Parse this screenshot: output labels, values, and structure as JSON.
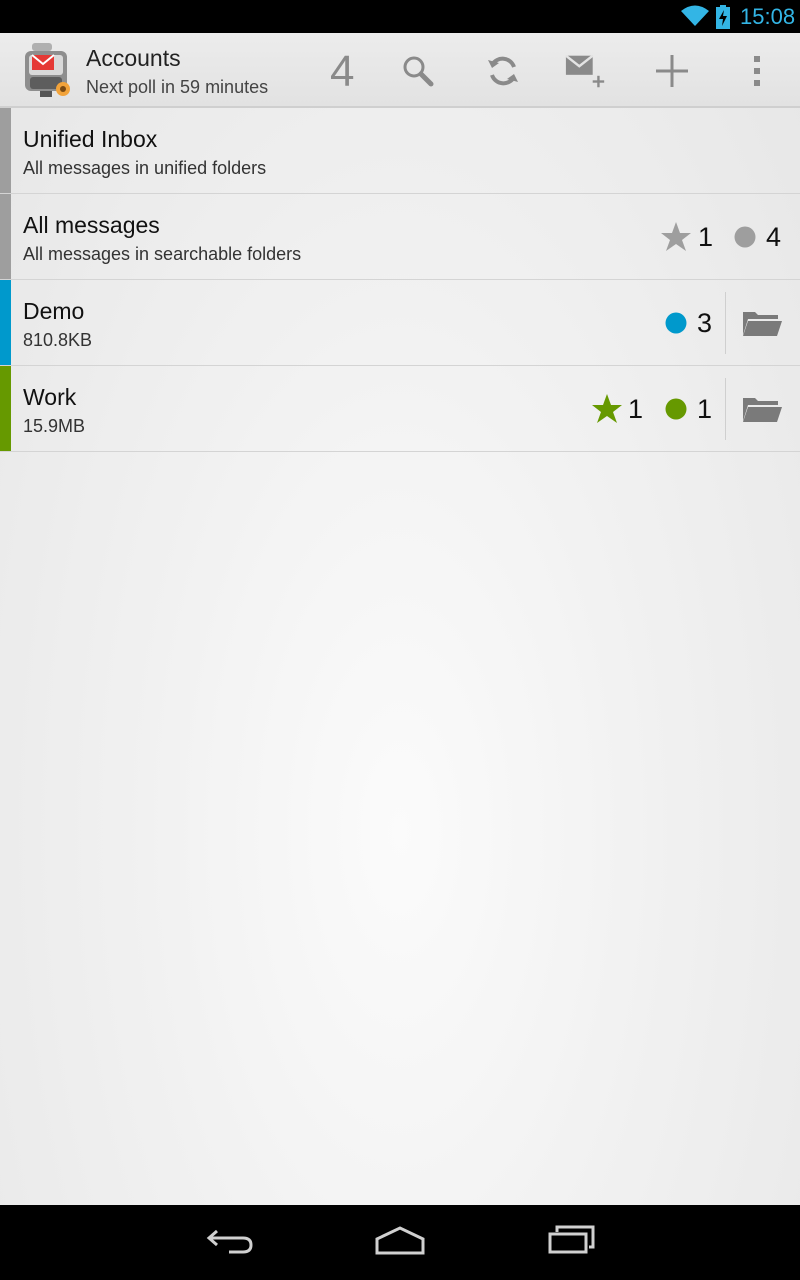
{
  "status_bar": {
    "time": "15:08",
    "icons": [
      "wifi-icon",
      "battery-charging-icon"
    ],
    "accent_color": "#33b5e5"
  },
  "action_bar": {
    "title": "Accounts",
    "subtitle": "Next poll in 59 minutes",
    "unread_count": "4",
    "actions": [
      "search-icon",
      "refresh-icon",
      "compose-icon",
      "add-icon",
      "overflow-menu-icon"
    ]
  },
  "accounts": [
    {
      "name": "Unified Inbox",
      "description": "All messages in unified folders",
      "color": "#9e9e9e"
    },
    {
      "name": "All messages",
      "description": "All messages in searchable folders",
      "color": "#9e9e9e",
      "starred": "1",
      "unread": "4"
    },
    {
      "name": "Demo",
      "description": "810.8KB",
      "color": "#0099cc",
      "unread": "3"
    },
    {
      "name": "Work",
      "description": "15.9MB",
      "color": "#669900",
      "starred": "1",
      "unread": "1"
    }
  ],
  "nav_bar": {
    "buttons": [
      "back-icon",
      "home-icon",
      "recent-apps-icon"
    ]
  }
}
